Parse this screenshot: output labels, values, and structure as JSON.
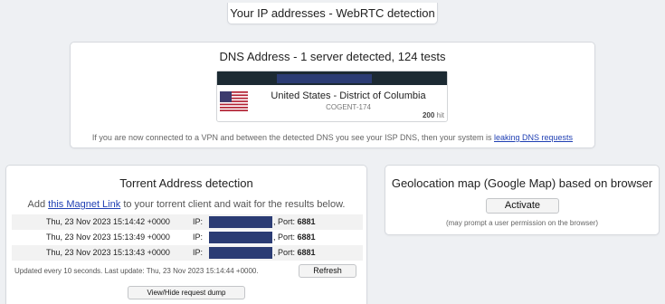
{
  "webrtc": {
    "title": "Your IP addresses - WebRTC detection"
  },
  "dns": {
    "title": "DNS Address - 1 server detected, 124 tests",
    "server": {
      "location": "United States - District of Columbia",
      "isp": "COGENT-174",
      "hits": "200",
      "hit_label": "hit",
      "flag_icon": "us-flag-icon"
    },
    "note_prefix": "If you are now connected to a VPN and between the detected DNS you see your ISP DNS, then your system is",
    "note_link": "leaking DNS requests"
  },
  "torrent": {
    "title": "Torrent Address detection",
    "instr_before": "Add",
    "instr_link": "this Magnet Link",
    "instr_after": "to your torrent client and wait for the results below.",
    "rows": [
      {
        "timestamp": "Thu, 23 Nov 2023 15:14:42 +0000",
        "ip_label": "IP:",
        "port_label": ", Port:",
        "port": "6881"
      },
      {
        "timestamp": "Thu, 23 Nov 2023 15:13:49 +0000",
        "ip_label": "IP:",
        "port_label": ", Port:",
        "port": "6881"
      },
      {
        "timestamp": "Thu, 23 Nov 2023 15:13:43 +0000",
        "ip_label": "IP:",
        "port_label": ", Port:",
        "port": "6881"
      }
    ],
    "update_text": "Updated every 10 seconds. Last update: Thu, 23 Nov 2023 15:14:44 +0000.",
    "refresh_label": "Refresh",
    "dump_label": "View/Hide request dump"
  },
  "geo": {
    "title": "Geolocation map (Google Map) based on browser",
    "activate_label": "Activate",
    "note": "(may prompt a user permission on the browser)"
  },
  "colors": {
    "redacted": "#2b3c74",
    "link": "#1f3fb3",
    "ip_bar": "#1c2a33"
  }
}
